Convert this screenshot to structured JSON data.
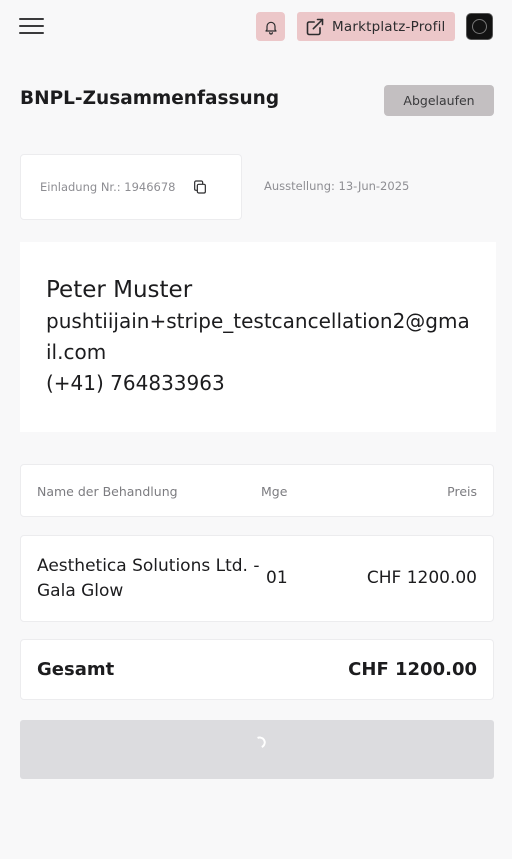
{
  "header": {
    "menu_icon": "hamburger-menu-icon",
    "bell_icon": "bell-icon",
    "profile_button_label": "Marktplatz-Profil",
    "profile_button_icon": "external-link-icon",
    "accent_color": "#ecc7c9"
  },
  "summary": {
    "title": "BNPL-Zusammenfassung",
    "status_label": "Abgelaufen"
  },
  "invitation": {
    "number_text": "Einladung Nr.: 1946678",
    "copy_icon": "copy-icon",
    "issue_date_text": "Ausstellung: 13-Jun-2025"
  },
  "customer": {
    "name": "Peter Muster",
    "email": "pushtiijain+stripe_testcancellation2@gmail.com",
    "phone": "(+41) 764833963"
  },
  "table": {
    "headers": {
      "name": "Name der Behandlung",
      "qty": "Mge",
      "price": "Preis"
    },
    "rows": [
      {
        "name": "Aesthetica Solutions Ltd. - Gala Glow",
        "qty": "01",
        "price": "CHF 1200.00"
      }
    ]
  },
  "total": {
    "label": "Gesamt",
    "value": "CHF 1200.00"
  }
}
